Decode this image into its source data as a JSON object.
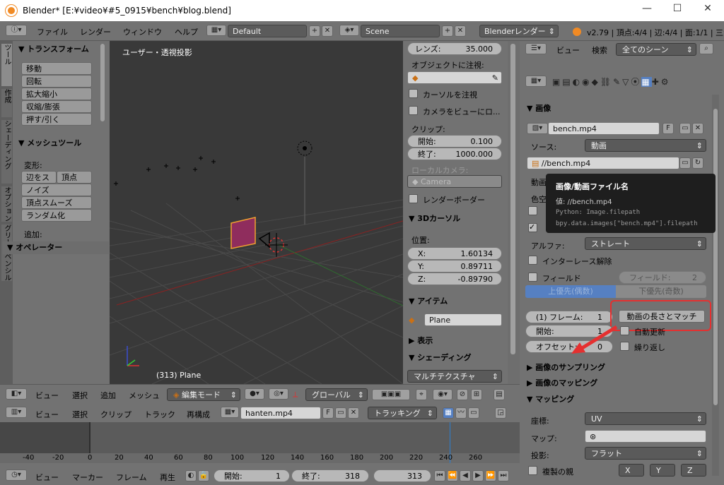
{
  "window": {
    "title": "Blender* [E:¥video¥#5_0915¥bench¥blog.blend]",
    "minimize": "—",
    "maximize": "☐",
    "close": "✕"
  },
  "menubar": {
    "menus": [
      "ファイル",
      "レンダー",
      "ウィンドウ",
      "ヘルプ"
    ],
    "layout": "Default",
    "scene": "Scene",
    "engine": "Blenderレンダー",
    "stats": "v2.79 | 頂点:4/4 | 辺:4/4 | 面:1/1 | 三角面"
  },
  "toolshelf": {
    "tabs": [
      "ツール",
      "作成",
      "シェーディング",
      "オプション",
      "グリースペンシル"
    ],
    "transform_header": "▼ トランスフォーム",
    "transform_buttons": [
      "移動",
      "回転",
      "拡大縮小",
      "収縮/膨張",
      "押す/引く"
    ],
    "mesh_header": "▼ メッシュツール",
    "deform_label": "変形:",
    "deform_row": [
      "辺をス",
      "頂点"
    ],
    "mesh_buttons": [
      "ノイズ",
      "頂点スムーズ",
      "ランダム化"
    ],
    "add_label": "追加:",
    "operator_header": "▼ オペレーター"
  },
  "viewport": {
    "label": "ユーザー・透視投影",
    "object_label": "(313) Plane"
  },
  "properties_n": {
    "lens_label": "レンズ:",
    "lens_value": "35.000",
    "look_at_label": "オブジェクトに注視:",
    "look_cursor": "カーソルを注視",
    "cam_to_view": "カメラをビューにロ...",
    "clip_label": "クリップ:",
    "clip_start_label": "開始:",
    "clip_start": "0.100",
    "clip_end_label": "終了:",
    "clip_end": "1000.000",
    "local_camera_label": "ローカルカメラ:",
    "camera_field": "Camera",
    "render_border": "レンダーボーダー",
    "cursor_header": "▼ 3Dカーソル",
    "location_label": "位置:",
    "x_label": "X:",
    "x": "1.60134",
    "y_label": "Y:",
    "y": "0.89711",
    "z_label": "Z:",
    "z": "-0.89790",
    "item_header": "▼ アイテム",
    "item_name": "Plane",
    "display_header": "▶ 表示",
    "shading_header": "▼ シェーディング",
    "shading_mode": "マルチテクスチャ"
  },
  "view3d_header": {
    "menus": [
      "ビュー",
      "選択",
      "追加",
      "メッシュ"
    ],
    "mode": "編集モード",
    "orientation": "グローバル"
  },
  "timeline_header": {
    "menus": [
      "ビュー",
      "選択",
      "クリップ",
      "トラック",
      "再構成"
    ],
    "clip": "hanten.mp4",
    "f_label": "F",
    "tracking": "トラッキング"
  },
  "ruler": {
    "ticks": [
      "-40",
      "-20",
      "0",
      "20",
      "40",
      "60",
      "80",
      "100",
      "120",
      "140",
      "160",
      "180",
      "200",
      "220",
      "240",
      "260"
    ]
  },
  "bottom_bar": {
    "menus": [
      "ビュー",
      "マーカー",
      "フレーム",
      "再生"
    ],
    "start_label": "開始:",
    "start": "1",
    "end_label": "終了:",
    "end": "318",
    "current": "313"
  },
  "outliner": {
    "menus": [
      "ビュー",
      "検索"
    ],
    "filter": "全てのシーン"
  },
  "props": {
    "image_header": "▼ 画像",
    "image_name": "bench.mp4",
    "image_f": "F",
    "source_label": "ソース:",
    "source": "動画",
    "filepath": "//bench.mp4",
    "partial_video": "動画",
    "partial_colorspace": "色空",
    "alpha_label": "アルファ:",
    "alpha": "ストレート",
    "deinterlace": "インターレース解除",
    "fields": "フィールド",
    "fields_count_label": "フィールド:",
    "fields_count": "2",
    "upper_first": "上優先(偶数)",
    "lower_first": "下優先(奇数)",
    "frames_label": "(1) フレーム:",
    "frames": "1",
    "match_movie": "動画の長さとマッチ",
    "start_label": "開始:",
    "start": "1",
    "auto_refresh": "自動更新",
    "offset_label": "オフセット:",
    "offset": "0",
    "cyclic": "繰り返し",
    "sampling_header": "▶ 画像のサンプリング",
    "mapping_header": "▶ 画像のマッピング",
    "mapping2_header": "▼ マッピング",
    "coords_label": "座標:",
    "coords": "UV",
    "map_label": "マップ:",
    "projection_label": "投影:",
    "projection": "フラット",
    "dupli_label": "複製の親",
    "xyz": [
      "X",
      "Y",
      "Z"
    ]
  },
  "tooltip": {
    "title": "画像/動画ファイル名",
    "value": "値: //bench.mp4",
    "python": "Python: Image.filepath",
    "data": "bpy.data.images[\"bench.mp4\"].filepath"
  },
  "colors": {
    "highlight": "#e53030",
    "selected_tab": "#5680c2",
    "face": "#8f2d5d"
  }
}
